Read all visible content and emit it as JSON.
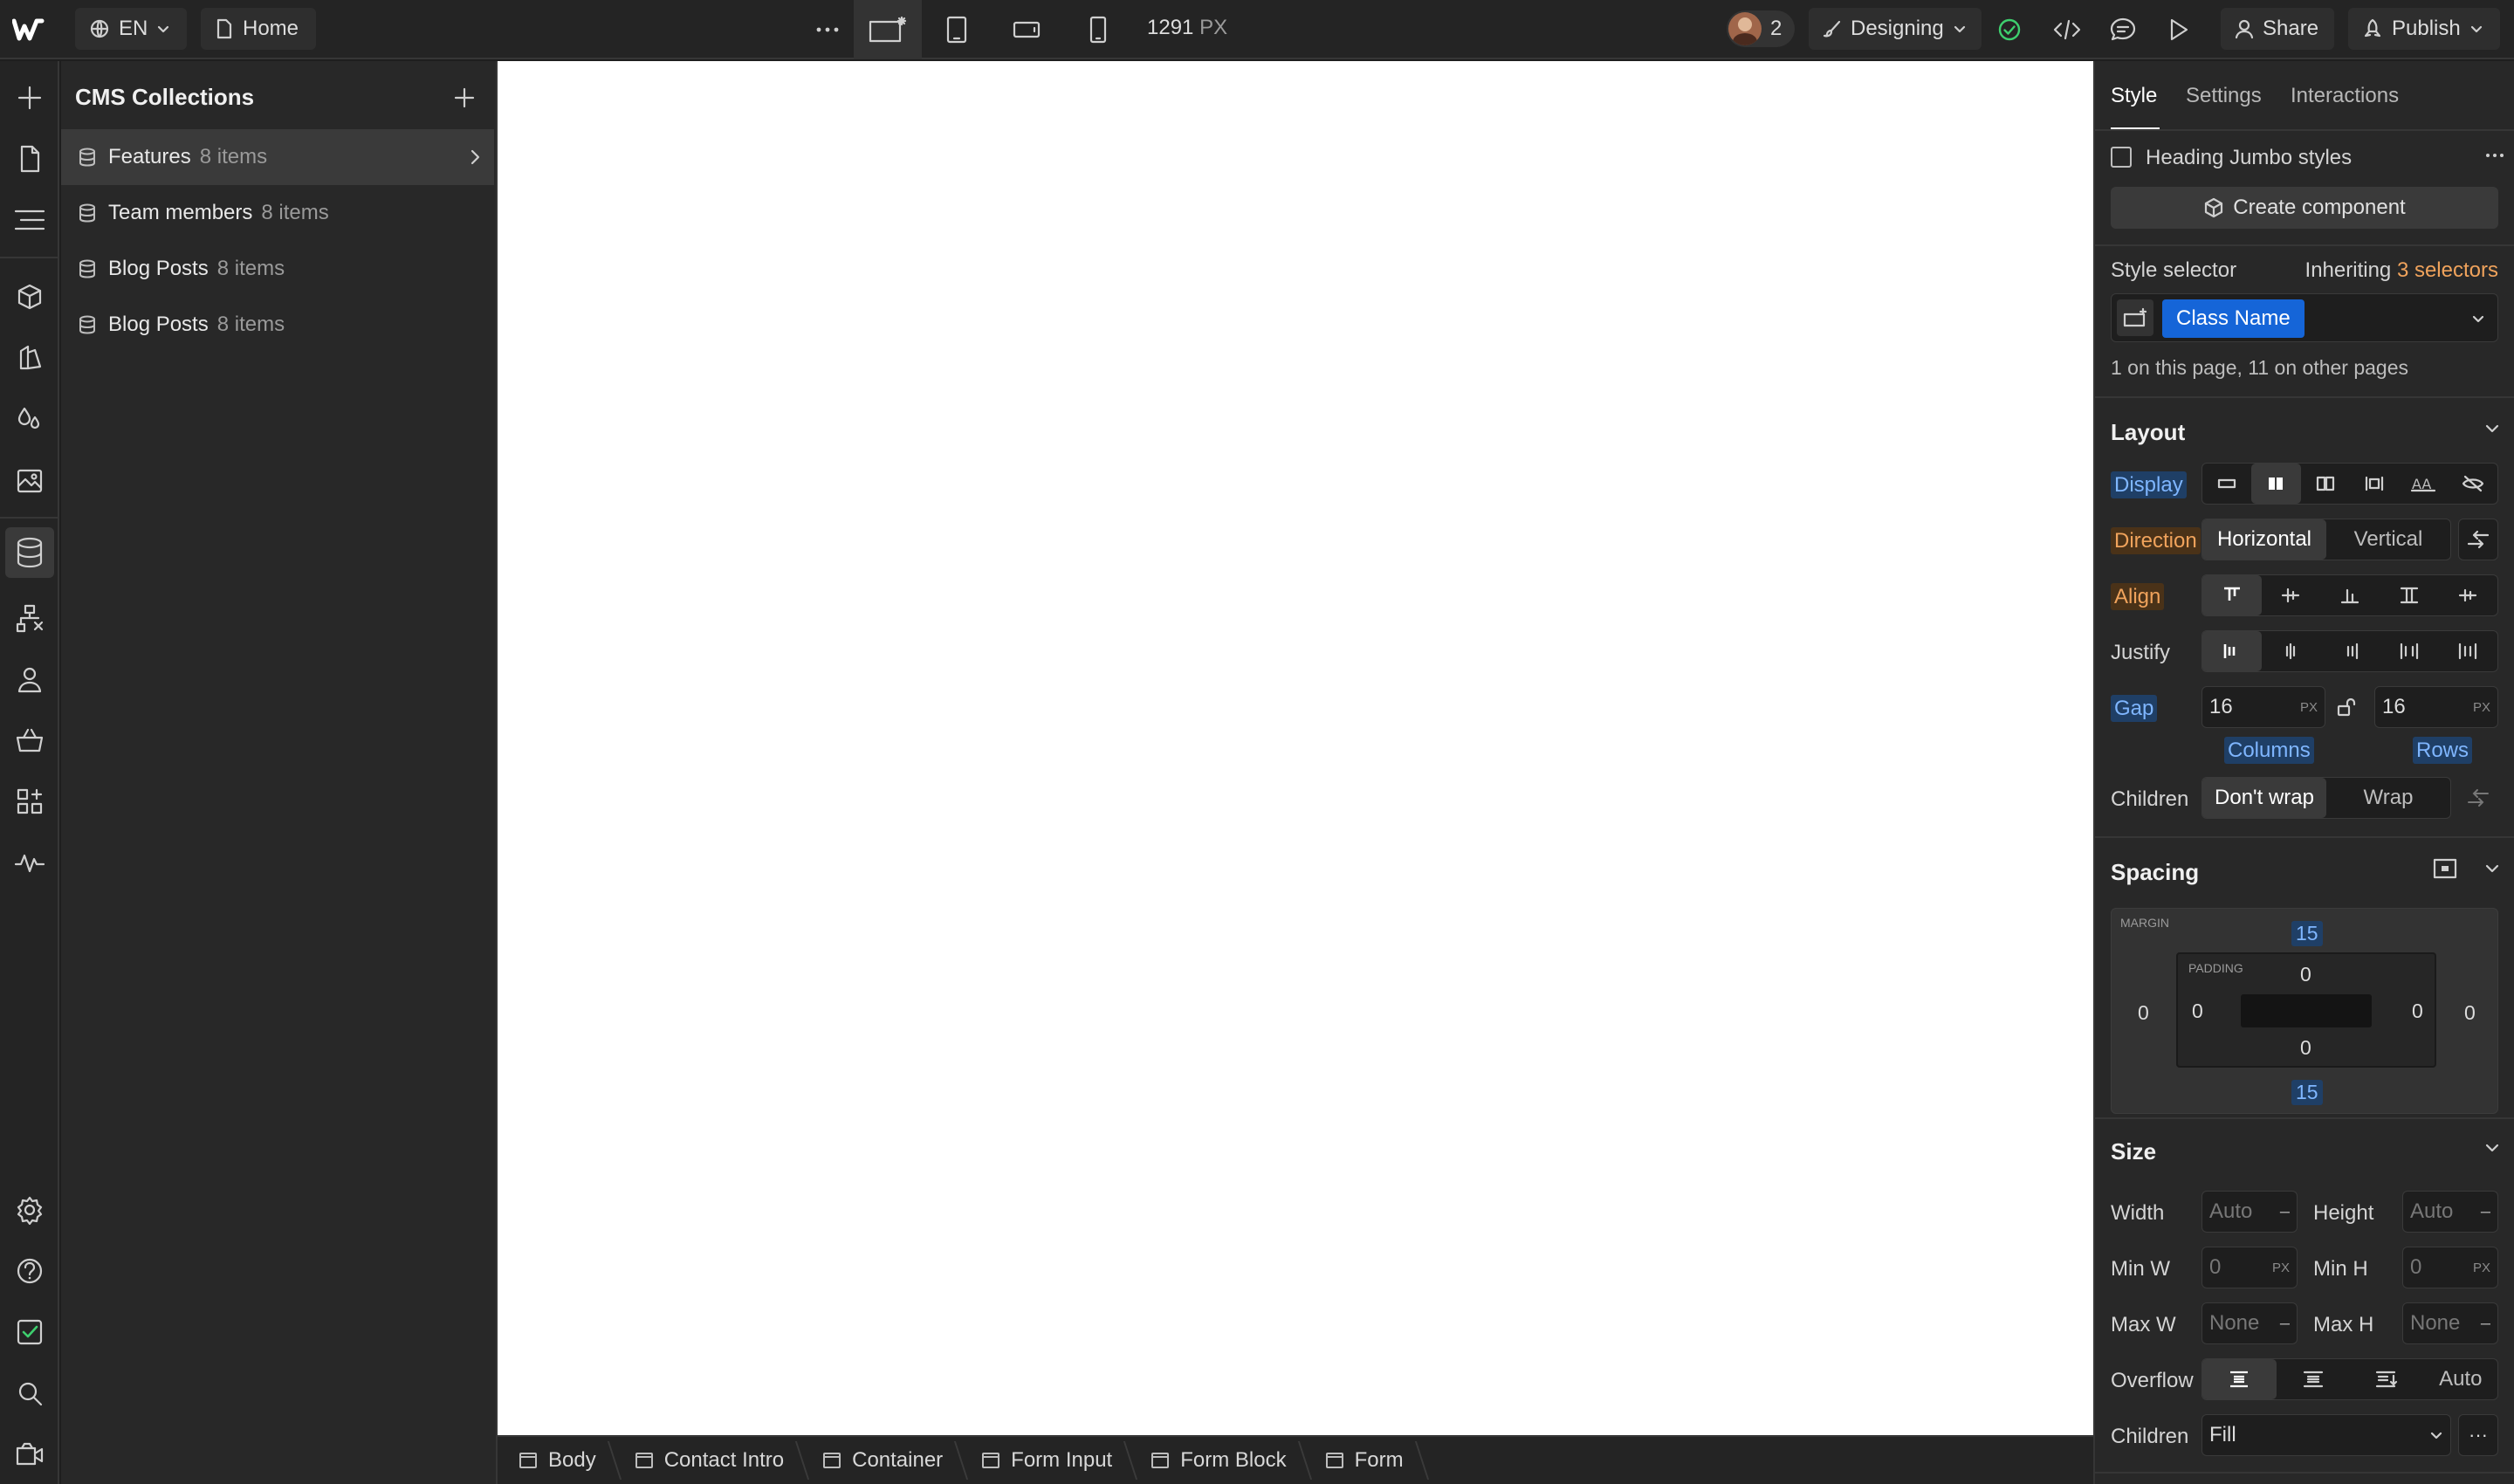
{
  "topbar": {
    "language": "EN",
    "page": "Home",
    "width_value": "1291",
    "width_unit": "PX",
    "collaborator_count": "2",
    "mode": "Designing",
    "share": "Share",
    "publish": "Publish"
  },
  "cms": {
    "title": "CMS Collections",
    "collections": [
      {
        "name": "Features",
        "count": "8 items"
      },
      {
        "name": "Team members",
        "count": "8 items"
      },
      {
        "name": "Blog Posts",
        "count": "8 items"
      },
      {
        "name": "Blog Posts",
        "count": "8 items"
      }
    ]
  },
  "breadcrumbs": [
    "Body",
    "Contact Intro",
    "Container",
    "Form Input",
    "Form Block",
    "Form"
  ],
  "style_panel": {
    "tabs": [
      "Style",
      "Settings",
      "Interactions"
    ],
    "element_styles_label": "Heading Jumbo styles",
    "create_component": "Create component",
    "style_selector_label": "Style selector",
    "inheriting_prefix": "Inheriting",
    "inheriting_count": "3 selectors",
    "class_name": "Class Name",
    "usage_note": "1 on this page, 11 on other pages",
    "layout": {
      "title": "Layout",
      "display_label": "Display",
      "direction_label": "Direction",
      "direction_options": [
        "Horizontal",
        "Vertical"
      ],
      "align_label": "Align",
      "justify_label": "Justify",
      "gap_label": "Gap",
      "gap_columns": "16",
      "gap_rows": "16",
      "gap_unit": "PX",
      "columns_label": "Columns",
      "rows_label": "Rows",
      "children_label": "Children",
      "wrap_options": [
        "Don't wrap",
        "Wrap"
      ]
    },
    "spacing": {
      "title": "Spacing",
      "margin_label": "MARGIN",
      "padding_label": "PADDING",
      "margin_top": "15",
      "margin_bottom": "15",
      "margin_left": "0",
      "margin_right": "0",
      "padding_top": "0",
      "padding_bottom": "0",
      "padding_left": "0",
      "padding_right": "0"
    },
    "size": {
      "title": "Size",
      "width_label": "Width",
      "width_value": "Auto",
      "height_label": "Height",
      "height_value": "Auto",
      "min_w_label": "Min W",
      "min_w_value": "0",
      "min_h_label": "Min H",
      "min_h_value": "0",
      "max_w_label": "Max W",
      "max_w_value": "None",
      "max_h_label": "Max H",
      "max_h_value": "None",
      "unit": "PX",
      "dash": "–",
      "overflow_label": "Overflow",
      "overflow_auto": "Auto",
      "children_label": "Children",
      "children_value": "Fill",
      "more": "···"
    }
  }
}
